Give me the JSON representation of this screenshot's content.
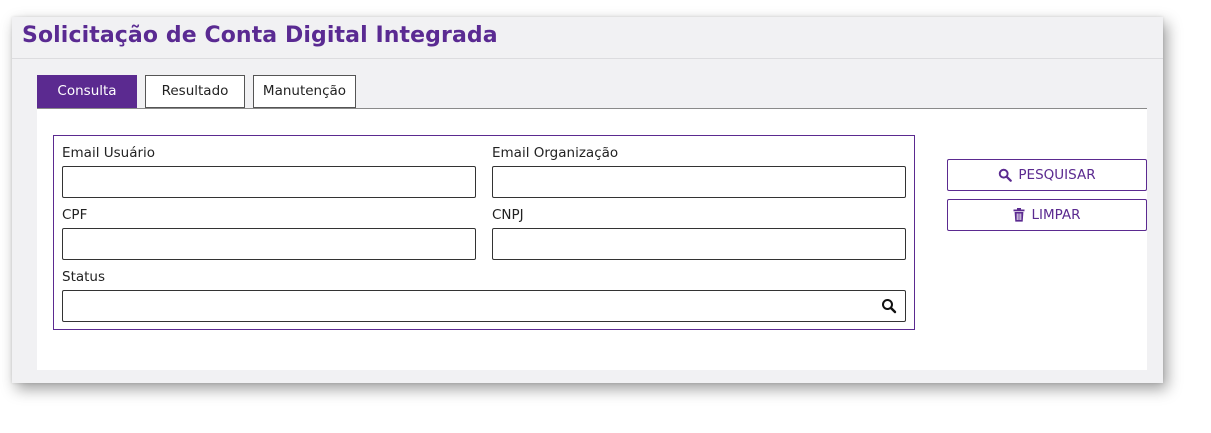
{
  "page": {
    "title": "Solicitação de Conta Digital Integrada"
  },
  "tabs": [
    {
      "label": "Consulta",
      "active": true
    },
    {
      "label": "Resultado",
      "active": false
    },
    {
      "label": "Manutenção",
      "active": false
    }
  ],
  "form": {
    "email_usuario": {
      "label": "Email Usuário",
      "value": ""
    },
    "email_organizacao": {
      "label": "Email Organização",
      "value": ""
    },
    "cpf": {
      "label": "CPF",
      "value": ""
    },
    "cnpj": {
      "label": "CNPJ",
      "value": ""
    },
    "status": {
      "label": "Status",
      "value": "",
      "icon": "search-icon"
    }
  },
  "actions": {
    "pesquisar": {
      "label": "PESQUISAR",
      "icon": "search-icon"
    },
    "limpar": {
      "label": "LIMPAR",
      "icon": "trash-icon"
    }
  },
  "colors": {
    "accent": "#5b2a90",
    "title": "#5a2a92",
    "background": "#f1f1f3"
  }
}
